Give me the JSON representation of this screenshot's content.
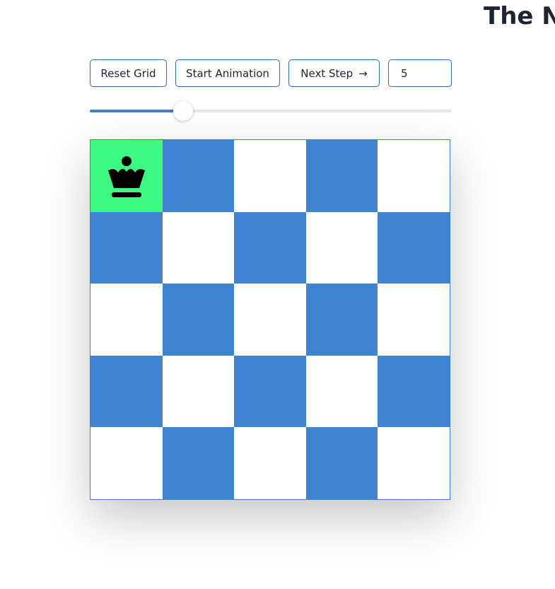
{
  "header": {
    "title": "The N"
  },
  "controls": {
    "reset_label": "Reset Grid",
    "start_label": "Start Animation",
    "next_label": "Next Step",
    "next_icon": "arrow-right-icon",
    "size_value": "5",
    "speed_slider_value": 0.257
  },
  "board": {
    "size": 5,
    "dark_color": "#3f84d0",
    "light_color": "#ffffff",
    "highlight_color": "#3dfb82",
    "queens": [
      {
        "row": 0,
        "col": 0,
        "icon": "queen-icon"
      }
    ]
  }
}
